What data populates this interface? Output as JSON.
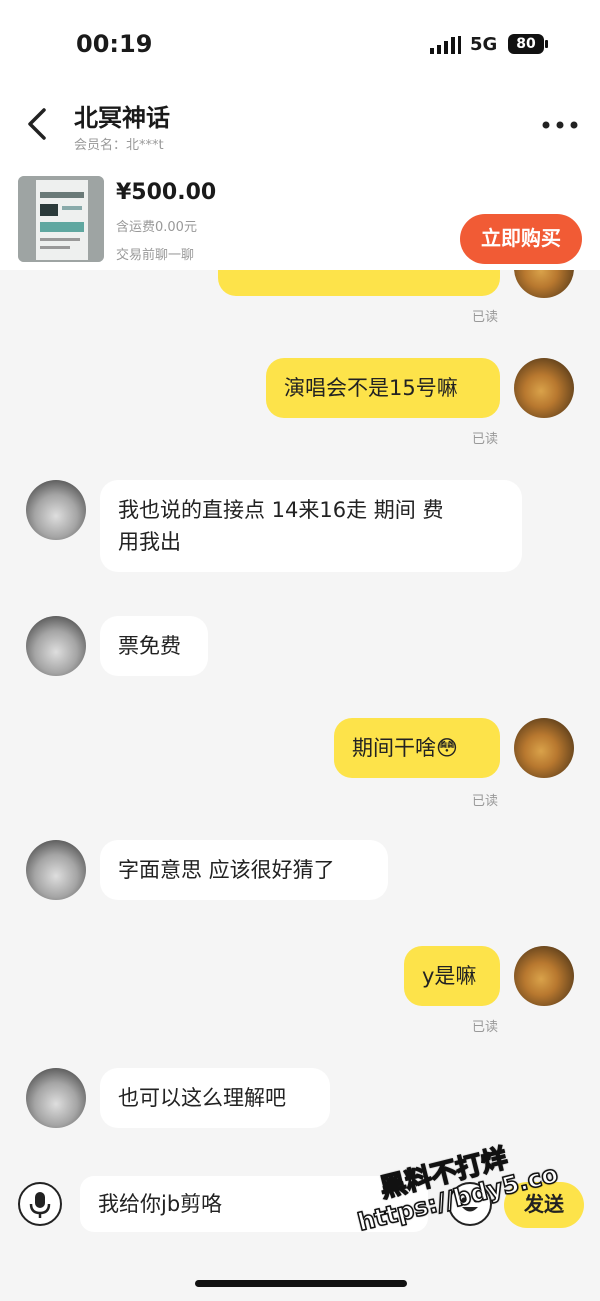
{
  "status_bar": {
    "time": "00:19",
    "network": "5G",
    "battery": "80"
  },
  "header": {
    "title": "北冥神话",
    "member": "会员名：北***t"
  },
  "product": {
    "price": "¥500.00",
    "shipping": "含运费0.00元",
    "note": "交易前聊一聊",
    "buy_label": "立即购买"
  },
  "messages": [
    {
      "from": "me",
      "text": "演唱会不是15号嘛",
      "read": "已读"
    },
    {
      "from": "them",
      "text_line1": "我也说的直接点 14来16走 期间  费",
      "text_line2": "用我出"
    },
    {
      "from": "them",
      "text": "票免费"
    },
    {
      "from": "me",
      "text": "期间干啥😳",
      "read": "已读"
    },
    {
      "from": "them",
      "text": "字面意思 应该很好猜了"
    },
    {
      "from": "me",
      "text": "y是嘛",
      "read": "已读"
    },
    {
      "from": "them",
      "text": "也可以这么理解吧"
    }
  ],
  "top_read": "已读",
  "input": {
    "value": "我给你jb剪咯",
    "send_label": "发送"
  },
  "watermark": {
    "line1": "黑料不打烊",
    "line2": "https://bdy5.co"
  },
  "colors": {
    "accent_yellow": "#fde34a",
    "buy_orange": "#f15b35"
  }
}
